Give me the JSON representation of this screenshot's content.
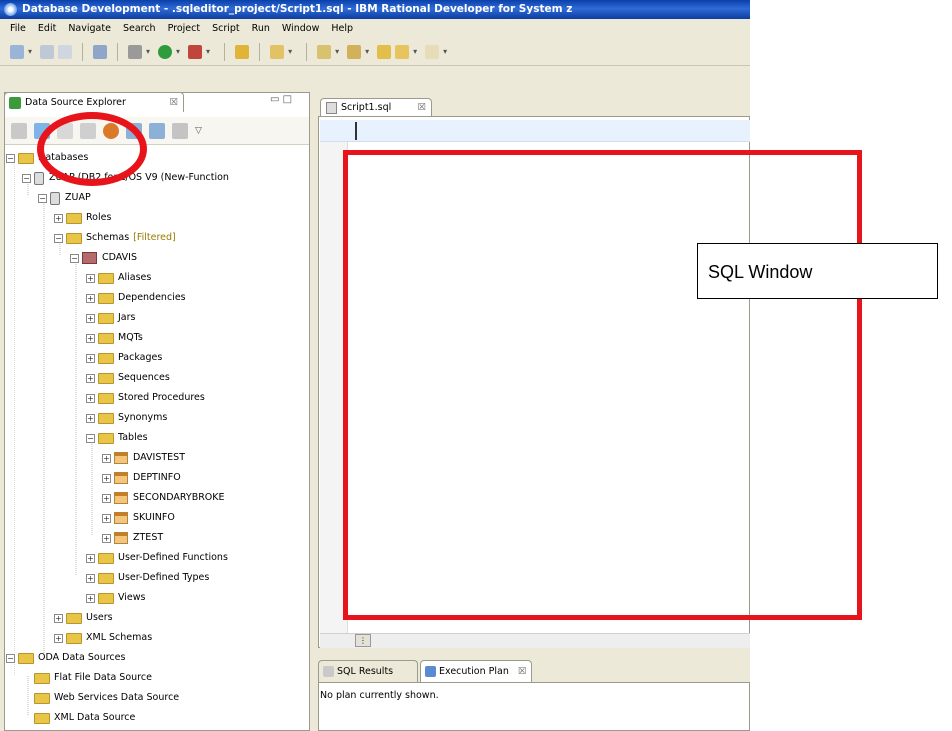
{
  "window": {
    "title": "Database Development - .sqleditor_project/Script1.sql - IBM Rational Developer for System z"
  },
  "menu": [
    "File",
    "Edit",
    "Navigate",
    "Search",
    "Project",
    "Script",
    "Run",
    "Window",
    "Help"
  ],
  "explorer": {
    "tab_label": "Data Source Explorer",
    "tab_close": "☒",
    "tree": [
      {
        "label": "Databases",
        "depth": 0,
        "icon": "folder-icon",
        "expanded": true
      },
      {
        "label": "ZUAP (DB2 for z/OS V9 (New-Function",
        "depth": 1,
        "icon": "database-icon",
        "expanded": true
      },
      {
        "label": "ZUAP",
        "depth": 2,
        "icon": "database-icon",
        "expanded": true
      },
      {
        "label": "Roles",
        "depth": 3,
        "icon": "folder-icon",
        "expanded": false
      },
      {
        "label": "Schemas",
        "depth": 3,
        "icon": "folder-icon",
        "expanded": true,
        "suffix": "[Filtered]"
      },
      {
        "label": "CDAVIS",
        "depth": 4,
        "icon": "schema-icon",
        "expanded": true
      },
      {
        "label": "Aliases",
        "depth": 5,
        "icon": "folder-icon",
        "expanded": false
      },
      {
        "label": "Dependencies",
        "depth": 5,
        "icon": "folder-icon",
        "expanded": false
      },
      {
        "label": "Jars",
        "depth": 5,
        "icon": "folder-icon",
        "expanded": false
      },
      {
        "label": "MQTs",
        "depth": 5,
        "icon": "folder-icon",
        "expanded": false
      },
      {
        "label": "Packages",
        "depth": 5,
        "icon": "folder-icon",
        "expanded": false
      },
      {
        "label": "Sequences",
        "depth": 5,
        "icon": "folder-icon",
        "expanded": false
      },
      {
        "label": "Stored Procedures",
        "depth": 5,
        "icon": "folder-icon",
        "expanded": false
      },
      {
        "label": "Synonyms",
        "depth": 5,
        "icon": "folder-icon",
        "expanded": false
      },
      {
        "label": "Tables",
        "depth": 5,
        "icon": "folder-icon",
        "expanded": true
      },
      {
        "label": "DAVISTEST",
        "depth": 6,
        "icon": "table-icon",
        "expanded": false
      },
      {
        "label": "DEPTINFO",
        "depth": 6,
        "icon": "table-icon",
        "expanded": false
      },
      {
        "label": "SECONDARYBROKE",
        "depth": 6,
        "icon": "table-icon",
        "expanded": false
      },
      {
        "label": "SKUINFO",
        "depth": 6,
        "icon": "table-icon",
        "expanded": false
      },
      {
        "label": "ZTEST",
        "depth": 6,
        "icon": "table-icon",
        "expanded": false
      },
      {
        "label": "User-Defined Functions",
        "depth": 5,
        "icon": "folder-icon",
        "expanded": false
      },
      {
        "label": "User-Defined Types",
        "depth": 5,
        "icon": "folder-icon",
        "expanded": false
      },
      {
        "label": "Views",
        "depth": 5,
        "icon": "folder-icon",
        "expanded": false
      },
      {
        "label": "Users",
        "depth": 3,
        "icon": "folder-icon",
        "expanded": false
      },
      {
        "label": "XML Schemas",
        "depth": 3,
        "icon": "folder-icon",
        "expanded": false
      },
      {
        "label": "ODA Data Sources",
        "depth": 0,
        "icon": "folder-icon",
        "expanded": true
      },
      {
        "label": "Flat File Data Source",
        "depth": 1,
        "icon": "folder-icon",
        "leaf": true
      },
      {
        "label": "Web Services Data Source",
        "depth": 1,
        "icon": "folder-icon",
        "leaf": true
      },
      {
        "label": "XML Data Source",
        "depth": 1,
        "icon": "folder-icon",
        "leaf": true
      }
    ]
  },
  "editor": {
    "tab_label": "Script1.sql",
    "tab_close": "☒"
  },
  "bottom_panel": {
    "tabs": [
      {
        "label": "SQL Results",
        "active": false
      },
      {
        "label": "Execution Plan",
        "active": true,
        "close": "☒"
      }
    ],
    "status": "No plan currently shown."
  },
  "annotation": {
    "callout": "SQL Window",
    "highlight_color": "#e8141b"
  },
  "colors": {
    "title_bar": "#2f6bd8",
    "chrome": "#ece9d8",
    "current_line": "#e8f2fe"
  }
}
